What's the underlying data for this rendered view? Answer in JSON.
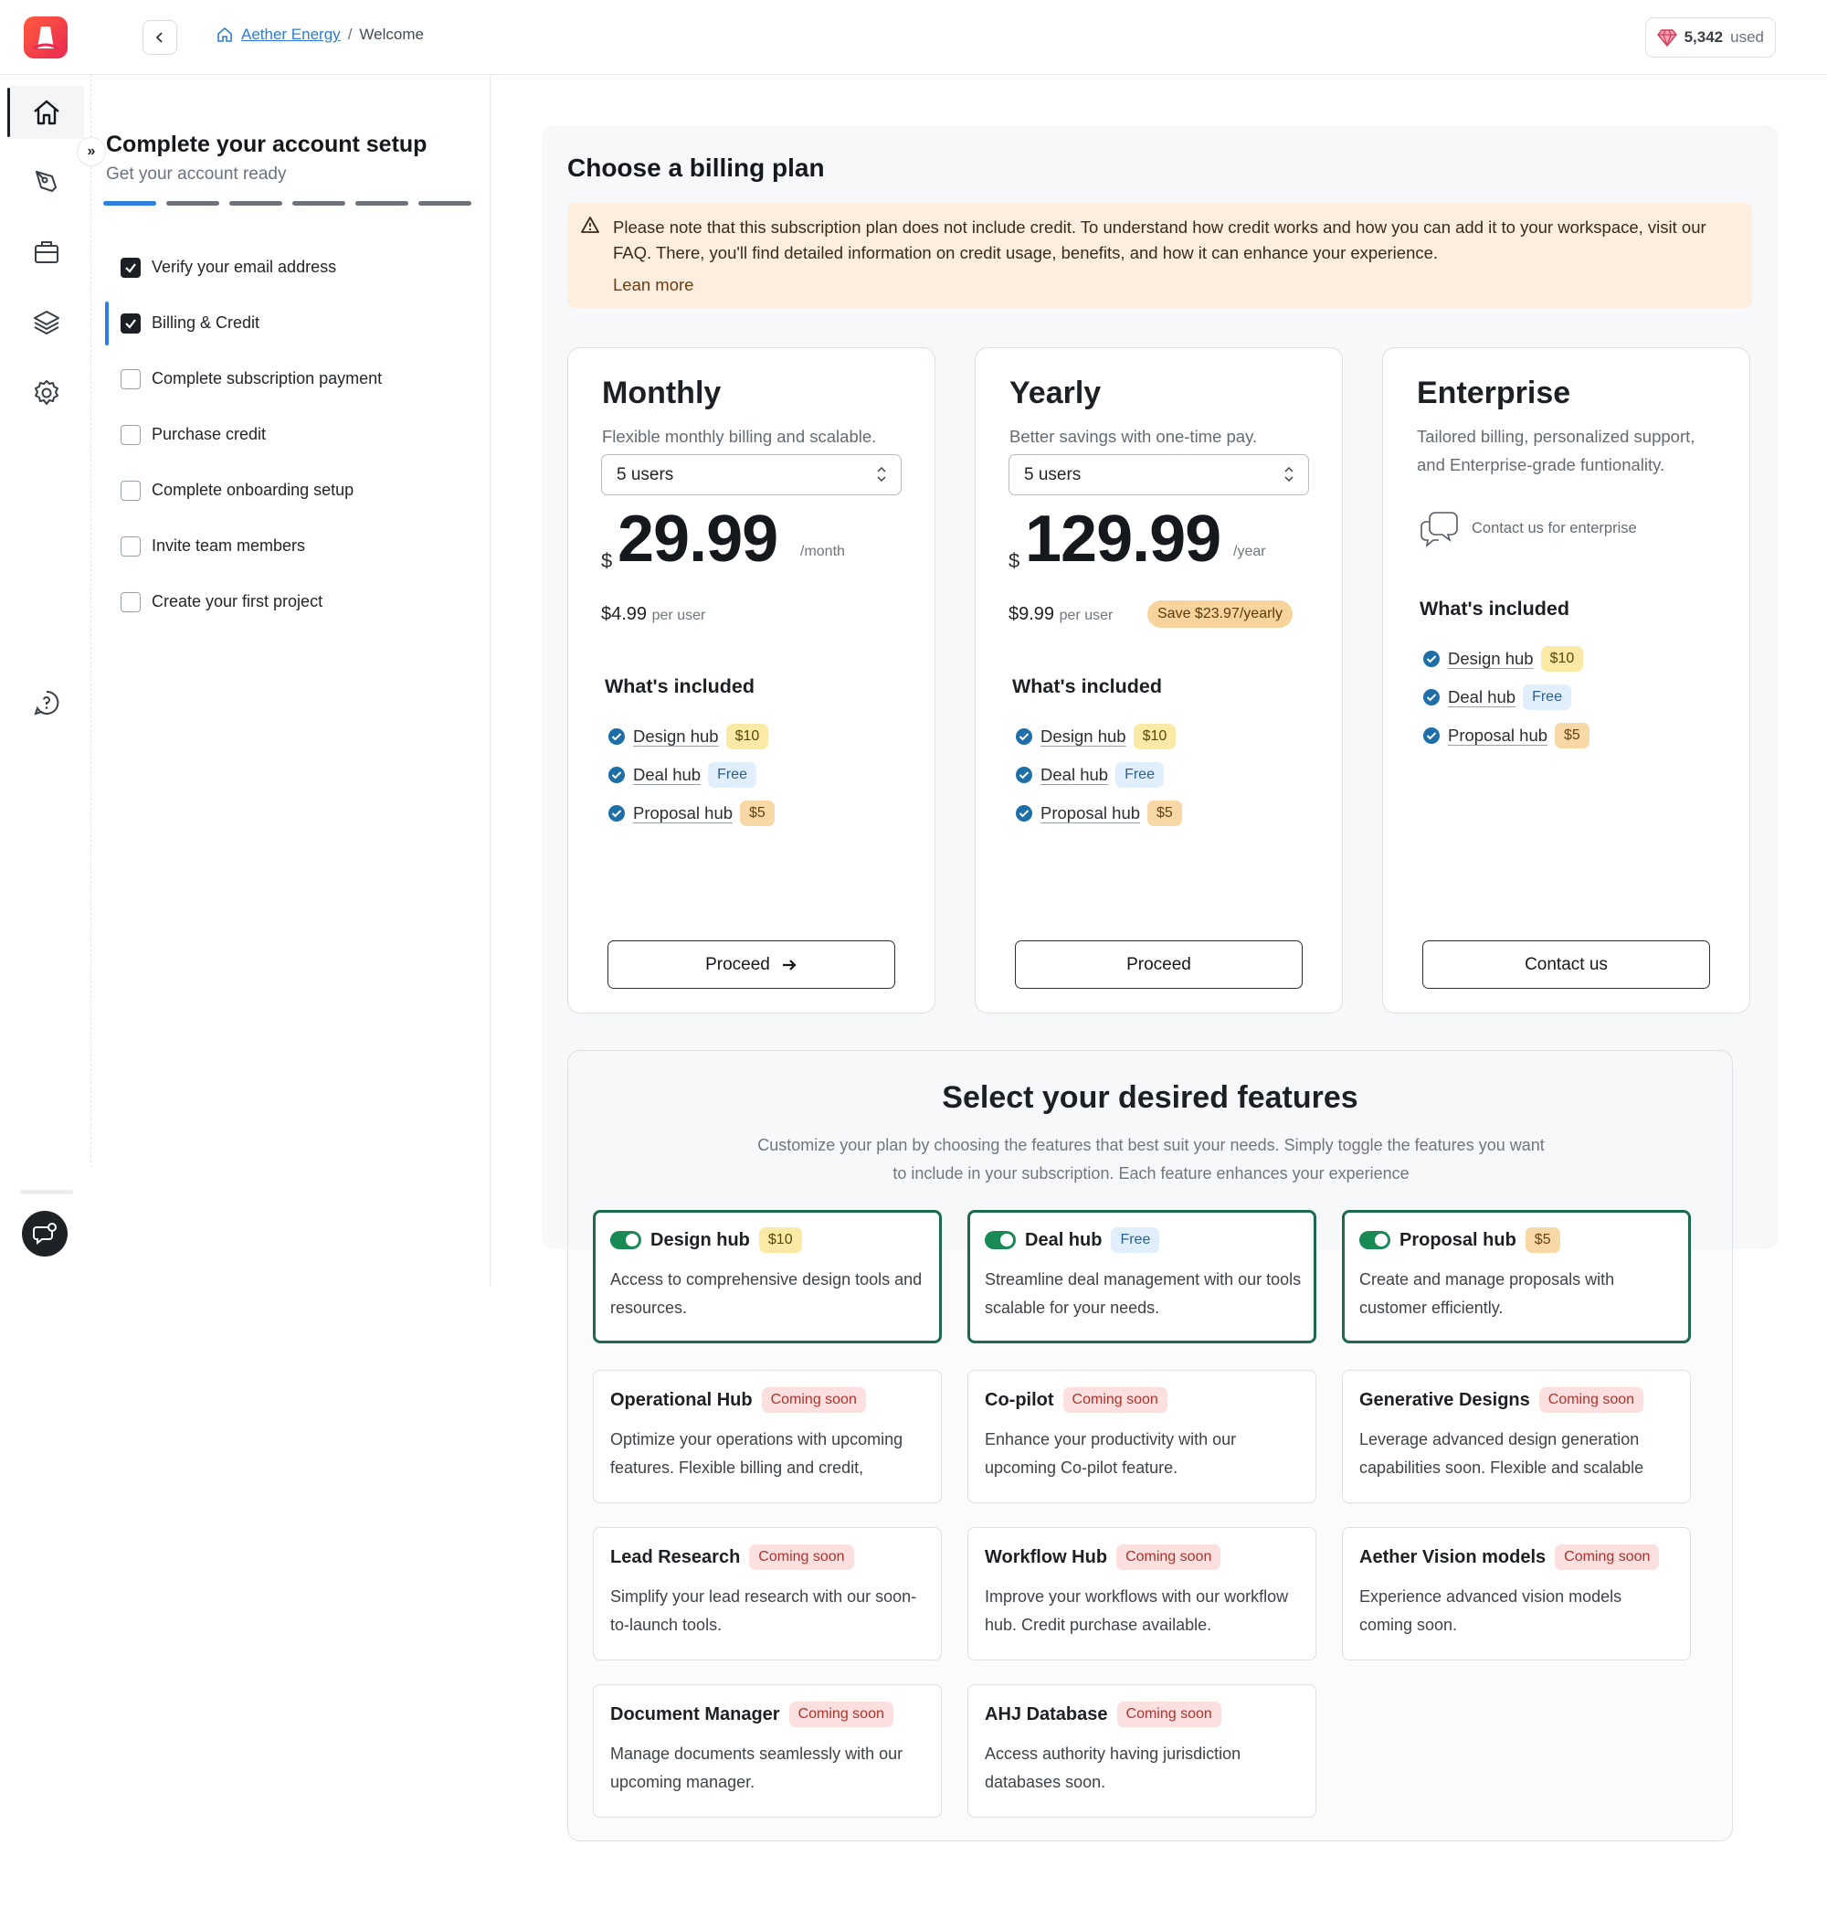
{
  "topbar": {
    "breadcrumb": {
      "org": "Aether Energy",
      "separator": "/",
      "current": "Welcome"
    },
    "credits": {
      "value": "5,342",
      "label": "used"
    }
  },
  "rail": {
    "items": [
      "home-icon",
      "pen-tool-icon",
      "briefcase-icon",
      "layers-icon",
      "settings-icon",
      "help-chat-icon"
    ],
    "expand_glyph": "»"
  },
  "setup": {
    "title": "Complete your account setup",
    "subtitle": "Get your account ready",
    "progress": {
      "completed": 1,
      "total": 6
    },
    "steps": [
      {
        "label": "Verify your email address",
        "checked": true
      },
      {
        "label": "Billing & Credit",
        "checked": true,
        "active": true
      },
      {
        "label": "Complete subscription payment",
        "checked": false
      },
      {
        "label": "Purchase credit",
        "checked": false
      },
      {
        "label": "Complete onboarding setup",
        "checked": false
      },
      {
        "label": "Invite team members",
        "checked": false
      },
      {
        "label": "Create your first project",
        "checked": false
      }
    ]
  },
  "billing": {
    "title": "Choose a billing plan",
    "notice": {
      "message": "Please note that this subscription plan does not include credit. To understand how credit works and how you can add it to your workspace, visit our FAQ. There, you'll find detailed information on credit usage, benefits, and how it can enhance your experience.",
      "link": "Lean more"
    },
    "plans": [
      {
        "name": "Monthly",
        "description": "Flexible monthly billing and scalable.",
        "users": "5 users",
        "currency": "$",
        "price": "29.99",
        "period": "/month",
        "per_user_price": "$4.99",
        "per_user_label": "per user",
        "included_title": "What's included",
        "features": [
          {
            "name": "Design hub",
            "tag": "$10"
          },
          {
            "name": "Deal hub",
            "tag": "Free"
          },
          {
            "name": "Proposal hub",
            "tag": "$5"
          }
        ],
        "button": "Proceed"
      },
      {
        "name": "Yearly",
        "description": "Better savings with one-time pay.",
        "users": "5 users",
        "currency": "$",
        "price": "129.99",
        "period": "/year",
        "per_user_price": "$9.99",
        "per_user_label": "per user",
        "savings": "Save $23.97/yearly",
        "included_title": "What's included",
        "features": [
          {
            "name": "Design hub",
            "tag": "$10"
          },
          {
            "name": "Deal hub",
            "tag": "Free"
          },
          {
            "name": "Proposal hub",
            "tag": "$5"
          }
        ],
        "button": "Proceed"
      },
      {
        "name": "Enterprise",
        "description": "Tailored billing, personalized support, and Enterprise-grade funtionality.",
        "contact_note": "Contact us for enterprise",
        "included_title": "What's included",
        "features": [
          {
            "name": "Design hub",
            "tag": "$10"
          },
          {
            "name": "Deal hub",
            "tag": "Free"
          },
          {
            "name": "Proposal hub",
            "tag": "$5"
          }
        ],
        "button": "Contact us"
      }
    ]
  },
  "features": {
    "title": "Select your desired features",
    "subtitle": "Customize your plan by choosing the features that best suit your needs. Simply toggle the features you want to include in your subscription. Each feature enhances your experience",
    "cards": [
      {
        "name": "Design hub",
        "tag": "$10",
        "enabled": true,
        "description": "Access to comprehensive design tools and resources."
      },
      {
        "name": "Deal hub",
        "tag": "Free",
        "enabled": true,
        "description": "Streamline deal management with our tools scalable for your needs."
      },
      {
        "name": "Proposal hub",
        "tag": "$5",
        "enabled": true,
        "description": "Create and manage proposals with customer efficiently."
      },
      {
        "name": "Operational Hub",
        "tag": "Coming soon",
        "description": "Optimize your operations with upcoming features. Flexible billing and credit,"
      },
      {
        "name": "Co-pilot",
        "tag": "Coming soon",
        "description": "Enhance your productivity with our upcoming Co-pilot feature."
      },
      {
        "name": "Generative Designs",
        "tag": "Coming soon",
        "description": "Leverage advanced design generation capabilities soon. Flexible and scalable"
      },
      {
        "name": "Lead Research",
        "tag": "Coming soon",
        "description": "Simplify your lead research with our soon-to-launch tools."
      },
      {
        "name": "Workflow Hub",
        "tag": "Coming soon",
        "description": "Improve your workflows with our workflow hub. Credit purchase available."
      },
      {
        "name": "Aether Vision models",
        "tag": "Coming soon",
        "description": "Experience advanced vision models coming soon."
      },
      {
        "name": "Document Manager",
        "tag": "Coming soon",
        "description": "Manage documents seamlessly with our upcoming manager."
      },
      {
        "name": "AHJ Database",
        "tag": "Coming soon",
        "description": "Access authority having jurisdiction databases soon."
      }
    ]
  },
  "colors": {
    "accent": "#2f7fe0",
    "brand": "#ea2a52",
    "enabled_border": "#1e6a4c",
    "toggle_on": "#1a8a55",
    "notice_bg": "#fdeee0"
  }
}
